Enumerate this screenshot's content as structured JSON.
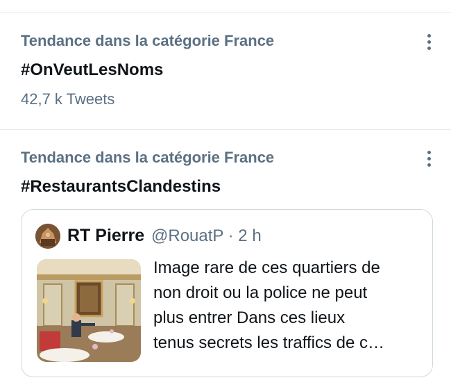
{
  "trends": [
    {
      "context": "Tendance dans la catégorie France",
      "name": "#OnVeutLesNoms",
      "count": "42,7 k Tweets"
    },
    {
      "context": "Tendance dans la catégorie France",
      "name": "#RestaurantsClandestins"
    }
  ],
  "tweet": {
    "author_name": "RT Pierre",
    "author_meta": "@RouatP · 2 h",
    "text_lines": [
      "Image rare de ces quartiers de",
      "non droit ou la police ne peut",
      "plus entrer Dans ces lieux",
      "tenus secrets les traffics de c…"
    ]
  },
  "icons": {
    "more": "more-vertical-icon"
  },
  "colors": {
    "secondary_text": "#5b7083",
    "primary_text": "#0f1419",
    "divider": "#e6ecf0",
    "card_border": "#cfd9de"
  }
}
